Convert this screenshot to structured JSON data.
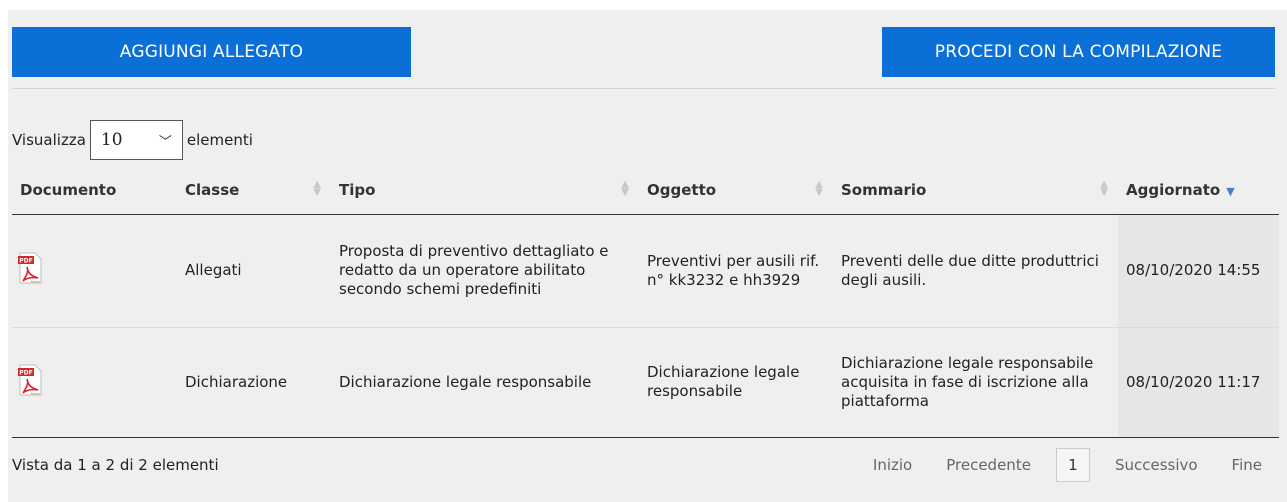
{
  "toolbar": {
    "add_label": "AGGIUNGI ALLEGATO",
    "proceed_label": "PROCEDI CON LA COMPILAZIONE"
  },
  "length": {
    "prefix": "Visualizza",
    "value": "10",
    "suffix": "elementi"
  },
  "table": {
    "headers": {
      "documento": "Documento",
      "classe": "Classe",
      "tipo": "Tipo",
      "oggetto": "Oggetto",
      "sommario": "Sommario",
      "aggiornato": "Aggiornato"
    },
    "rows": [
      {
        "icon": "pdf-file-icon",
        "classe": "Allegati",
        "tipo": "Proposta di preventivo dettagliato e redatto da un operatore abilitato secondo schemi predefiniti",
        "oggetto": "Preventivi per ausili rif. n° kk3232 e hh3929",
        "sommario": "Preventi delle due ditte produttrici degli ausili.",
        "aggiornato": "08/10/2020 14:55"
      },
      {
        "icon": "pdf-file-icon",
        "classe": "Dichiarazione",
        "tipo": "Dichiarazione legale responsabile",
        "oggetto": "Dichiarazione legale responsabile",
        "sommario": "Dichiarazione legale responsabile acquisita in fase di iscrizione alla piattaforma",
        "aggiornato": "08/10/2020 11:17"
      }
    ]
  },
  "footer": {
    "info": "Vista da 1 a 2 di 2 elementi",
    "pagination": {
      "first": "Inizio",
      "prev": "Precedente",
      "current": "1",
      "next": "Successivo",
      "last": "Fine"
    }
  },
  "colors": {
    "primary": "#0a6fd6",
    "background": "#efefef",
    "sorted_column": "#e6e6e6",
    "pdf_red": "#d9262b"
  }
}
